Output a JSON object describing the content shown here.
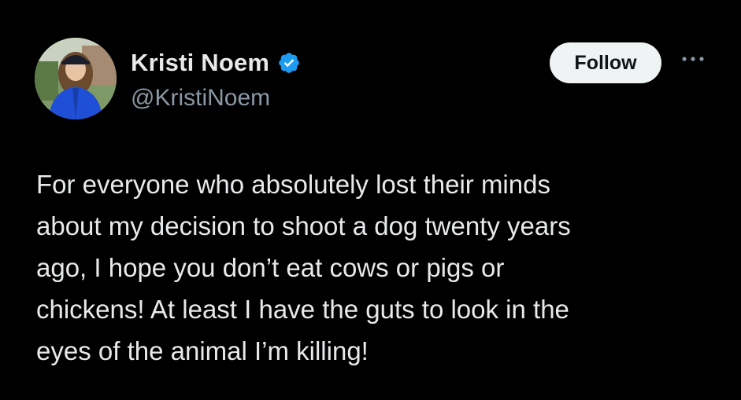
{
  "tweet": {
    "author": {
      "display_name": "Kristi Noem",
      "handle": "@KristiNoem",
      "verified": true,
      "avatar": "profile-photo"
    },
    "follow_label": "Follow",
    "more_icon": "more-horizontal-icon",
    "text": "For everyone who absolutely lost their minds\nabout my decision to shoot a dog twenty years\nago, I hope you don’t eat cows or pigs or\nchickens! At least I have the guts to look in the\neyes of the animal I’m killing!"
  },
  "colors": {
    "background": "#000000",
    "text": "#e7e9ea",
    "secondary_text": "#8b98a5",
    "verified_badge": "#1d9bf0",
    "follow_button_bg": "#eff3f4",
    "follow_button_text": "#0f1419"
  }
}
